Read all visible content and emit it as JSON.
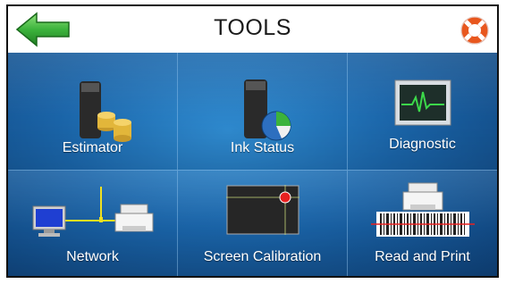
{
  "header": {
    "title": "TOOLS"
  },
  "tiles": [
    {
      "label": "Estimator"
    },
    {
      "label": "Ink Status"
    },
    {
      "label": "Diagnostic"
    },
    {
      "label": "Network"
    },
    {
      "label": "Screen Calibration"
    },
    {
      "label": "Read and Print"
    }
  ],
  "colors": {
    "grid_blue": "#1a64a8",
    "back_green": "#3cb33c",
    "help_orange": "#e8571e"
  },
  "icons": [
    "back-arrow-icon",
    "lifebuoy-help-icon",
    "estimator-icon",
    "ink-status-icon",
    "diagnostic-icon",
    "network-icon",
    "screen-calibration-icon",
    "read-and-print-icon"
  ]
}
